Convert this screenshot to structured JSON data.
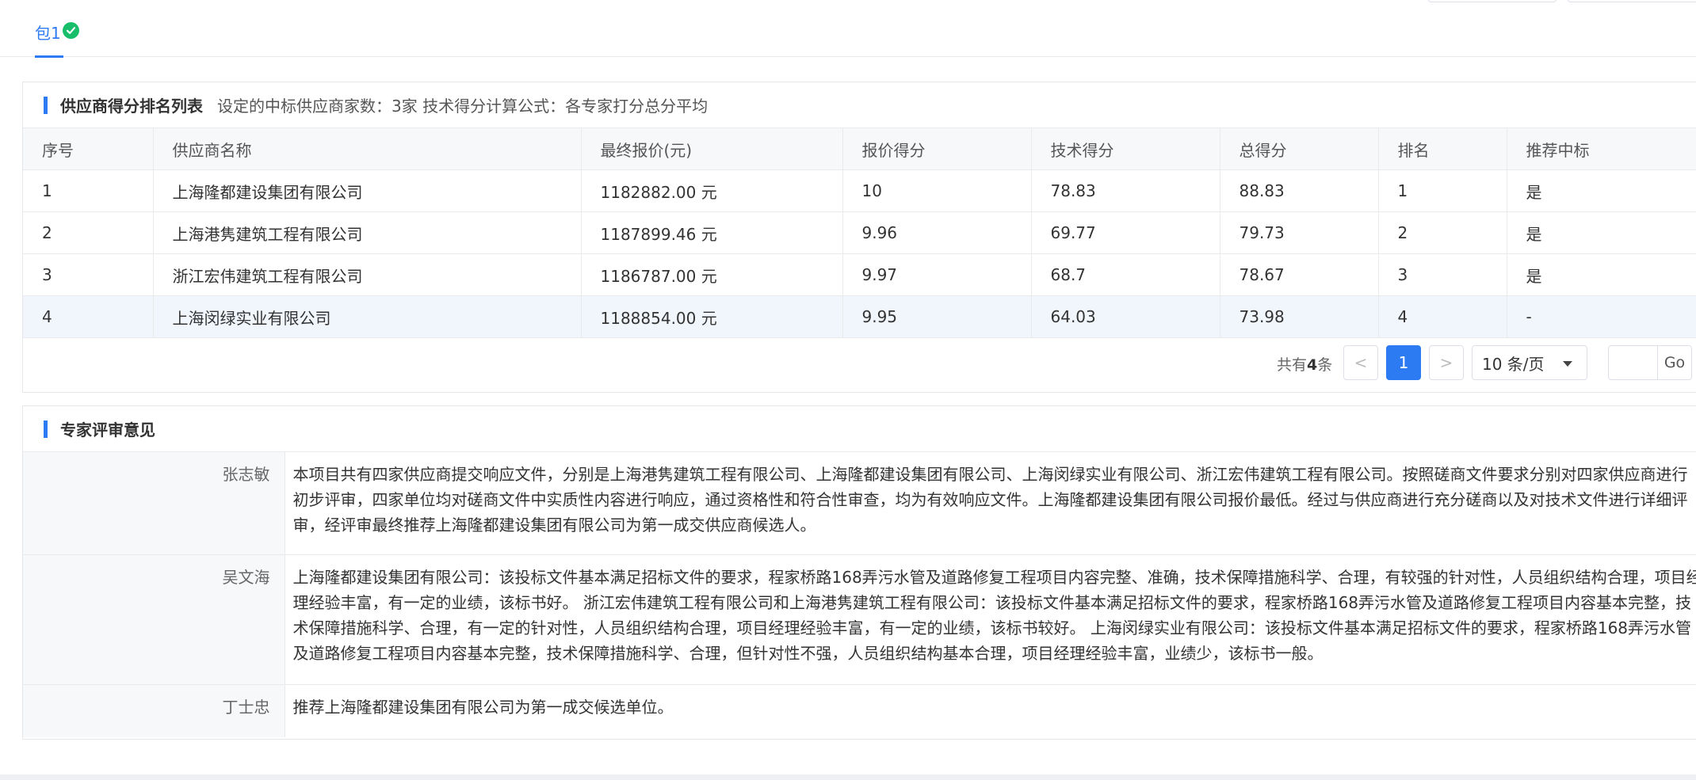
{
  "tabs": [
    {
      "label": "包1"
    }
  ],
  "ranking": {
    "title": "供应商得分排名列表",
    "subtitle": "设定的中标供应商家数：3家 技术得分计算公式：各专家打分总分平均",
    "columns": [
      "序号",
      "供应商名称",
      "最终报价(元)",
      "报价得分",
      "技术得分",
      "总得分",
      "排名",
      "推荐中标"
    ],
    "rows": [
      [
        "1",
        "上海隆都建设集团有限公司",
        "1182882.00 元",
        "10",
        "78.83",
        "88.83",
        "1",
        "是"
      ],
      [
        "2",
        "上海港隽建筑工程有限公司",
        "1187899.46 元",
        "9.96",
        "69.77",
        "79.73",
        "2",
        "是"
      ],
      [
        "3",
        "浙江宏伟建筑工程有限公司",
        "1186787.00 元",
        "9.97",
        "68.7",
        "78.67",
        "3",
        "是"
      ],
      [
        "4",
        "上海闵绿实业有限公司",
        "1188854.00 元",
        "9.95",
        "64.03",
        "73.98",
        "4",
        "-"
      ]
    ]
  },
  "pagination": {
    "total_prefix": "共有",
    "total_count": "4",
    "total_suffix": "条",
    "prev": "<",
    "current": "1",
    "next": ">",
    "page_size": "10 条/页",
    "go_label": "Go"
  },
  "opinions": {
    "title": "专家评审意见",
    "items": [
      {
        "name": "张志敏",
        "text": "本项目共有四家供应商提交响应文件，分别是上海港隽建筑工程有限公司、上海隆都建设集团有限公司、上海闵绿实业有限公司、浙江宏伟建筑工程有限公司。按照磋商文件要求分别对四家供应商进行初步评审，四家单位均对磋商文件中实质性内容进行响应，通过资格性和符合性审查，均为有效响应文件。上海隆都建设集团有限公司报价最低。经过与供应商进行充分磋商以及对技术文件进行详细评审，经评审最终推荐上海隆都建设集团有限公司为第一成交供应商候选人。"
      },
      {
        "name": "吴文海",
        "text": "上海隆都建设集团有限公司：该投标文件基本满足招标文件的要求，程家桥路168弄污水管及道路修复工程项目内容完整、准确，技术保障措施科学、合理，有较强的针对性，人员组织结构合理，项目经理经验丰富，有一定的业绩，该标书好。 浙江宏伟建筑工程有限公司和上海港隽建筑工程有限公司：该投标文件基本满足招标文件的要求，程家桥路168弄污水管及道路修复工程项目内容基本完整，技术保障措施科学、合理，有一定的针对性，人员组织结构合理，项目经理经验丰富，有一定的业绩，该标书较好。 上海闵绿实业有限公司：该投标文件基本满足招标文件的要求，程家桥路168弄污水管及道路修复工程项目内容基本完整，技术保障措施科学、合理，但针对性不强，人员组织结构基本合理，项目经理经验丰富，业绩少，该标书一般。"
      },
      {
        "name": "丁士忠",
        "text": "推荐上海隆都建设集团有限公司为第一成交候选单位。"
      }
    ]
  },
  "colors": {
    "accent": "#2d7bf3",
    "success": "#19be6b"
  },
  "icons": {
    "tab_status": "check-circle-icon"
  }
}
